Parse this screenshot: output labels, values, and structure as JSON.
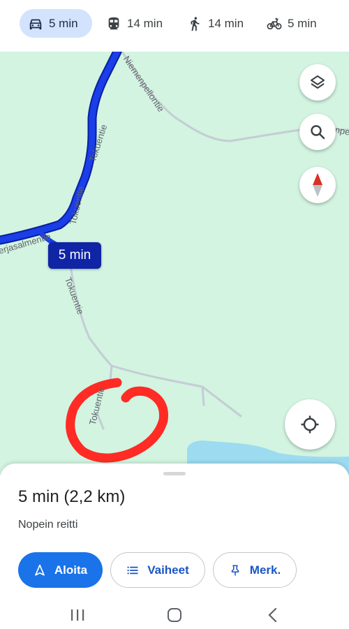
{
  "travel_modes": [
    {
      "mode": "car",
      "icon": "car-icon",
      "time": "5 min",
      "selected": true
    },
    {
      "mode": "transit",
      "icon": "train-icon",
      "time": "14 min",
      "selected": false
    },
    {
      "mode": "walk",
      "icon": "walk-icon",
      "time": "14 min",
      "selected": false
    },
    {
      "mode": "bike",
      "icon": "bike-icon",
      "time": "5 min",
      "selected": false
    }
  ],
  "map": {
    "road_labels": {
      "tokuentie_upper": "Tokuentie",
      "tokuentie_middle": "Tokuentie",
      "niemenpellontie": "Niemenpellontie",
      "jarjasalmentie": "erjasalmentie",
      "tokuentie_lower": "Tokuentie",
      "tokuentie_bottom": "Tokuentie",
      "edge_clip": "npe"
    },
    "route_duration": "5 min",
    "controls": [
      "layers-icon",
      "search-icon",
      "compass-icon",
      "my-location-icon"
    ],
    "colors": {
      "land": "#d2f4e1",
      "route": "#1a3ee8",
      "water": "#9ddbf0",
      "annotation": "#ff2b24"
    }
  },
  "route_sheet": {
    "summary": "5 min (2,2 km)",
    "subtitle": "Nopein reitti",
    "buttons": {
      "start": "Aloita",
      "steps": "Vaiheet",
      "pin": "Merk."
    }
  },
  "system_nav": [
    "recents-icon",
    "home-icon",
    "back-icon"
  ]
}
